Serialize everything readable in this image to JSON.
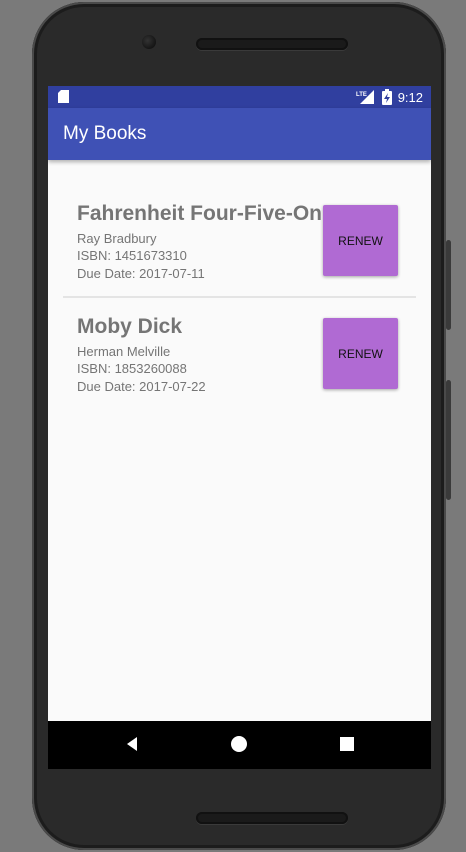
{
  "status_bar": {
    "time": "9:12",
    "network": "LTE",
    "icons": [
      "sd-card-icon",
      "signal-icon",
      "battery-charging-icon"
    ]
  },
  "app_bar": {
    "title": "My Books"
  },
  "books": [
    {
      "title": "Fahrenheit Four-Five-One",
      "author": "Ray Bradbury",
      "isbn": "ISBN: 1451673310",
      "due_date": "Due Date: 2017-07-11",
      "button_label": "RENEW"
    },
    {
      "title": "Moby Dick",
      "author": "Herman Melville",
      "isbn": "ISBN: 1853260088",
      "due_date": "Due Date: 2017-07-22",
      "button_label": "RENEW"
    }
  ],
  "nav_bar": {
    "icons": [
      "back-icon",
      "home-icon",
      "recents-icon"
    ]
  },
  "colors": {
    "status_bar": "#303f9f",
    "app_bar": "#3f51b5",
    "renew_button": "#b06ad3",
    "text_secondary": "#757575"
  }
}
